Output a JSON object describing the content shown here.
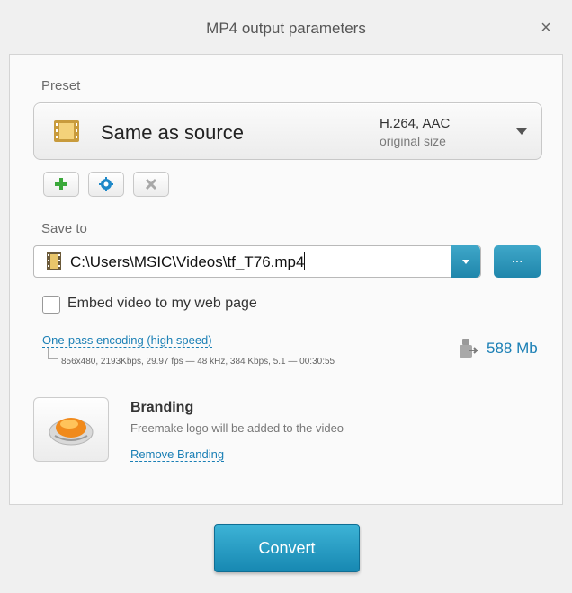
{
  "window": {
    "title": "MP4 output parameters",
    "close_label": "×"
  },
  "preset": {
    "label": "Preset",
    "name": "Same as source",
    "codec": "H.264, AAC",
    "size": "original size"
  },
  "save_to": {
    "label": "Save to",
    "path": "C:\\Users\\MSIC\\Videos\\tf_T76.mp4",
    "browse_label": "..."
  },
  "embed": {
    "label": "Embed video to my web page",
    "checked": false
  },
  "encoding": {
    "link": "One-pass encoding (high speed)",
    "specs": "856x480, 2193Kbps, 29.97 fps — 48 kHz, 384 Kbps, 5.1 — 00:30:55",
    "file_size": "588 Mb"
  },
  "branding": {
    "title": "Branding",
    "description": "Freemake logo will be added to the video",
    "remove_link": "Remove Branding"
  },
  "actions": {
    "convert_label": "Convert"
  },
  "colors": {
    "accent": "#1f86ab",
    "link": "#1a7fb5",
    "add_icon": "#3aa83a",
    "settings_icon": "#1e88c8"
  },
  "icons": {
    "preset": "film-strip-icon",
    "add": "plus-icon",
    "settings": "gear-icon",
    "delete": "x-icon",
    "path": "film-strip-icon",
    "file_size": "disk-arrow-icon",
    "branding": "freemake-logo-icon"
  }
}
